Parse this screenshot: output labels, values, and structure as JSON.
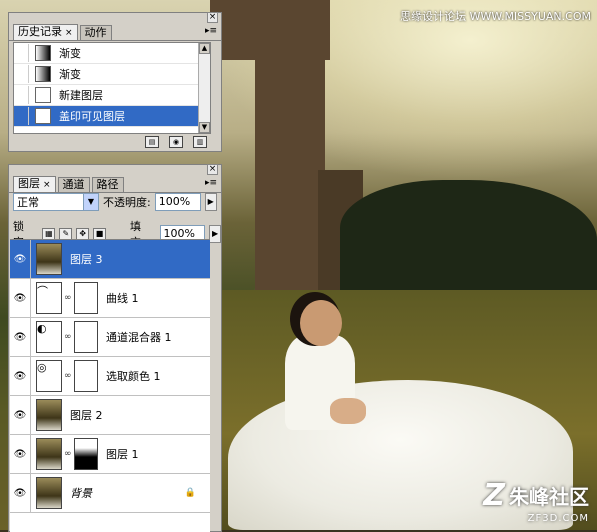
{
  "watermark": "思缘设计论坛 WWW.MISSYUAN.COM",
  "logo": {
    "mark": "Z",
    "name": "朱峰社区",
    "url": "ZF3D.COM"
  },
  "history_panel": {
    "tabs": [
      "历史记录",
      "动作"
    ],
    "items": [
      {
        "label": "渐变",
        "icon": "gradient-icon",
        "selected": false
      },
      {
        "label": "渐变",
        "icon": "gradient-icon",
        "selected": false
      },
      {
        "label": "新建图层",
        "icon": "document-icon",
        "selected": false
      },
      {
        "label": "盖印可见图层",
        "icon": "document-icon",
        "selected": true
      }
    ]
  },
  "layers_panel": {
    "tabs": [
      "图层",
      "通道",
      "路径"
    ],
    "blend_mode": "正常",
    "opacity_label": "不透明度:",
    "opacity": "100%",
    "lock_label": "锁定:",
    "fill_label": "填充:",
    "fill": "100%",
    "layers": [
      {
        "name": "图层 3",
        "type": "pixel",
        "selected": true
      },
      {
        "name": "曲线 1",
        "type": "curves",
        "selected": false
      },
      {
        "name": "通道混合器 1",
        "type": "channel-mixer",
        "selected": false
      },
      {
        "name": "选取颜色 1",
        "type": "selective-color",
        "selected": false
      },
      {
        "name": "图层 2",
        "type": "pixel",
        "selected": false
      },
      {
        "name": "图层 1",
        "type": "pixel-mask",
        "selected": false
      },
      {
        "name": "背景",
        "type": "background",
        "selected": false,
        "locked": true
      }
    ]
  },
  "colors": {
    "selection": "#316ac5",
    "panel": "#d4d0c8"
  }
}
